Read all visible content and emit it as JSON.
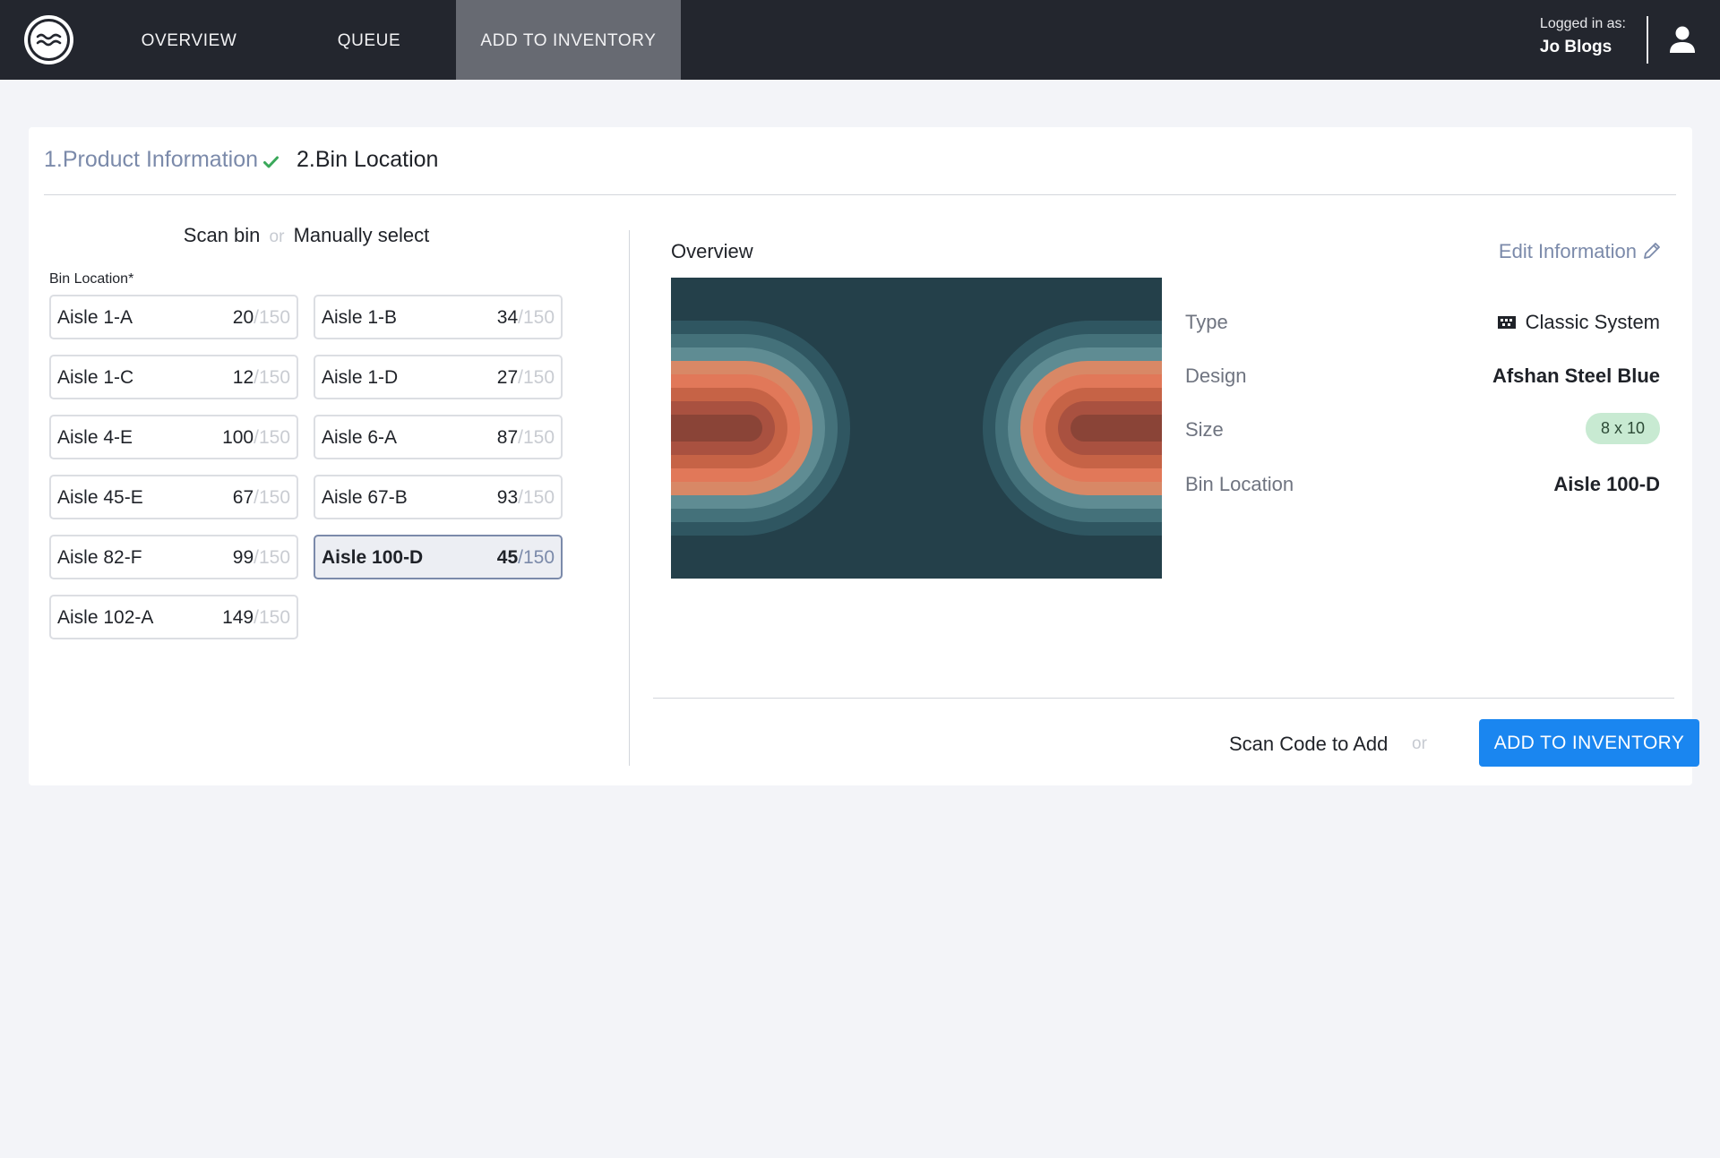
{
  "nav": {
    "tabs": [
      {
        "label": "OVERVIEW"
      },
      {
        "label": "QUEUE"
      },
      {
        "label": "ADD TO INVENTORY"
      }
    ],
    "logged_in_label": "Logged in as:",
    "user_name": "Jo Blogs"
  },
  "steps": {
    "step1": "1.Product Information",
    "step2": "2.Bin Location"
  },
  "bin_select": {
    "scan_label": "Scan bin",
    "or_label": "or",
    "manual_label": "Manually select",
    "field_label": "Bin Location*",
    "capacity": "/150",
    "bins": [
      {
        "name": "Aisle 1-A",
        "count": "20"
      },
      {
        "name": "Aisle 1-B",
        "count": "34"
      },
      {
        "name": "Aisle 1-C",
        "count": "12"
      },
      {
        "name": "Aisle 1-D",
        "count": "27"
      },
      {
        "name": "Aisle 4-E",
        "count": "100"
      },
      {
        "name": "Aisle 6-A",
        "count": "87"
      },
      {
        "name": "Aisle 45-E",
        "count": "67"
      },
      {
        "name": "Aisle 67-B",
        "count": "93"
      },
      {
        "name": "Aisle 82-F",
        "count": "99"
      },
      {
        "name": "Aisle 100-D",
        "count": "45",
        "selected": true
      },
      {
        "name": "Aisle 102-A",
        "count": "149"
      }
    ]
  },
  "overview": {
    "title": "Overview",
    "edit_label": "Edit Information",
    "rows": {
      "type": {
        "label": "Type",
        "value": "Classic System"
      },
      "design": {
        "label": "Design",
        "value": "Afshan Steel Blue"
      },
      "size": {
        "label": "Size",
        "value": "8 x 10"
      },
      "bin": {
        "label": "Bin Location",
        "value": "Aisle 100-D"
      }
    }
  },
  "actions": {
    "scan_code_label": "Scan Code to Add",
    "or_label": "or",
    "add_button": "ADD TO INVENTORY"
  },
  "colors": {
    "nav_bg": "#23262e",
    "active_tab": "#676a72",
    "accent_blue": "#1a86f0",
    "muted_link": "#7b8aaa",
    "badge_green": "#c8ead2"
  }
}
